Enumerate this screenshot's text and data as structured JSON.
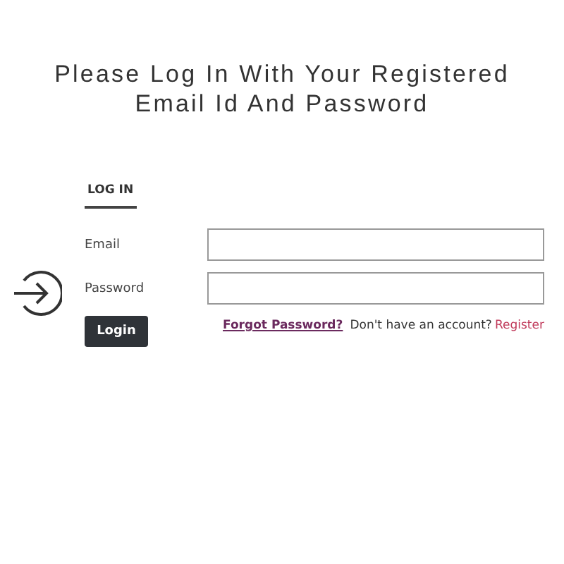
{
  "heading": "Please Log In With Your Registered Email Id And Password",
  "tabs": [
    {
      "label": "LOG IN",
      "selected": true
    }
  ],
  "fields": [
    {
      "label": "Email"
    },
    {
      "label": "Password"
    }
  ],
  "login_button": "Login",
  "forgot_link": "Forgot Password?",
  "register_prompt": "Don't have an account?",
  "register_link": "Register"
}
